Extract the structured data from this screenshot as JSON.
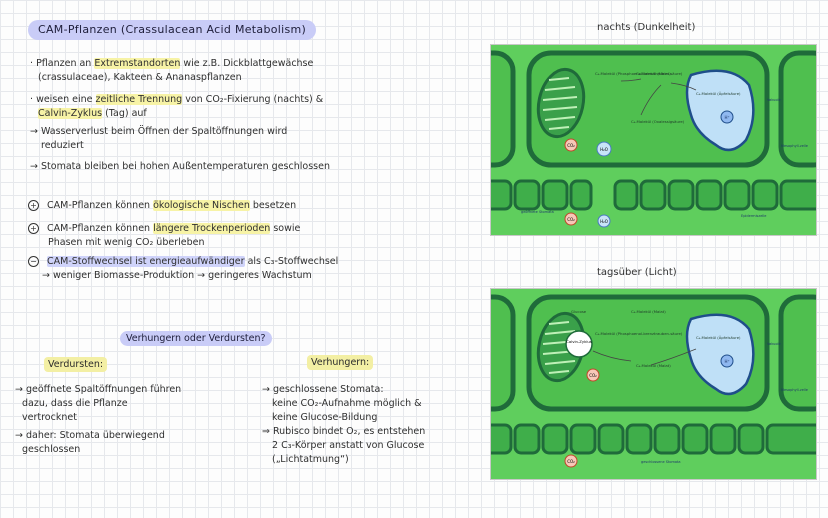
{
  "title": "CAM-Pflanzen (Crassulacean Acid Metabolism)",
  "bullets": [
    {
      "prefix": "·",
      "parts": [
        "Pflanzen an ",
        "Extremstandorten",
        " wie z.B. Dickblattgewächse"
      ],
      "line2": "(crassulaceae), Kakteen & Ananaspflanzen"
    },
    {
      "prefix": "·",
      "parts": [
        "weisen eine ",
        "zeitliche Trennung",
        " von CO₂-Fixierung (nachts) &"
      ],
      "line2": "Calvin-Zyklus",
      "line2b": " (Tag) auf"
    },
    {
      "prefix": "→",
      "text": "Wasserverlust beim Öffnen der Spaltöffnungen wird",
      "line2": "reduziert"
    },
    {
      "prefix": "→",
      "text": "Stomata bleiben bei hohen Außentemperaturen geschlossen"
    }
  ],
  "pros_cons": [
    {
      "sign": "+",
      "pre": "CAM-Pflanzen können ",
      "hl": "ökologische Nischen",
      "post": " besetzen",
      "line2": ""
    },
    {
      "sign": "+",
      "pre": "CAM-Pflanzen können ",
      "hl": "längere Trockenperioden",
      "post": " sowie",
      "line2": "Phasen mit wenig CO₂ überleben"
    },
    {
      "sign": "−",
      "pre": "",
      "hl": "CAM-Stoffwechsel ist energieaufwändiger",
      "post": " als C₃-Stoffwechsel",
      "line2": "→ weniger Biomasse-Produktion → geringeres Wachstum"
    }
  ],
  "section_title": "Verhungern oder Verdursten?",
  "verdursten": {
    "label": "Verdursten:",
    "items": [
      "→ geöffnete Spaltöffnungen führen",
      "dazu, dass die Pflanze",
      "vertrocknet",
      "→ daher: Stomata überwiegend",
      "geschlossen"
    ]
  },
  "verhungern": {
    "label": "Verhungern:",
    "items": [
      "→ geschlossene Stomata:",
      "keine CO₂-Aufnahme möglich &",
      "keine Glucose-Bildung",
      "⇒ Rubisco bindet O₂, es entstehen",
      "2 C₃-Körper anstatt von Glucose",
      "(„Lichtatmung“)"
    ]
  },
  "diagram_night": {
    "caption": "nachts (Dunkelheit)",
    "labels": {
      "c4_left": "C₄-Molekül (Phosphoenol-brenztrauben-säure)",
      "c4_mid": "C₄-Molekül (Malat)",
      "c4_oxal": "C₄-Molekül (Oxalessigsäure)",
      "c4_vac": "C₄-Molekül (Äpfelsäure)",
      "h_plus": "H⁺",
      "co2": "CO₂",
      "h2o": "H₂O",
      "co2_bottom": "CO₂",
      "h2o_bottom": "H₂O",
      "stomata": "geöffnete Stomata",
      "vakuole": "Vakuole",
      "mesophyll": "Mesophyll-zelle",
      "epidermis": "Epidermiszelle"
    }
  },
  "diagram_day": {
    "caption": "tagsüber (Licht)",
    "labels": {
      "glucose": "Glucose",
      "calvin": "Calvin-Zyklus",
      "c4_left": "C₄-Molekül (Phosphoenol-brenztrauben-säure)",
      "c4_mid": "C₄-Molekül (Malat)",
      "c4_oxal": "C₄-Molekül (Malat)",
      "c4_vac": "C₄-Molekül (Äpfelsäure)",
      "h_plus": "H⁺",
      "co2": "CO₂",
      "co2_bottom": "CO₂",
      "stomata": "geschlossene Stomata",
      "vakuole": "Vakuole",
      "mesophyll": "Mesophyll-zelle"
    }
  },
  "colors": {
    "pill": "#c9ccf7",
    "highlight_yellow": "#f7f3a6",
    "leaf_green": "#5fce5d",
    "dark_green": "#1f6b3a",
    "vacuole": "#bfe0f7"
  }
}
